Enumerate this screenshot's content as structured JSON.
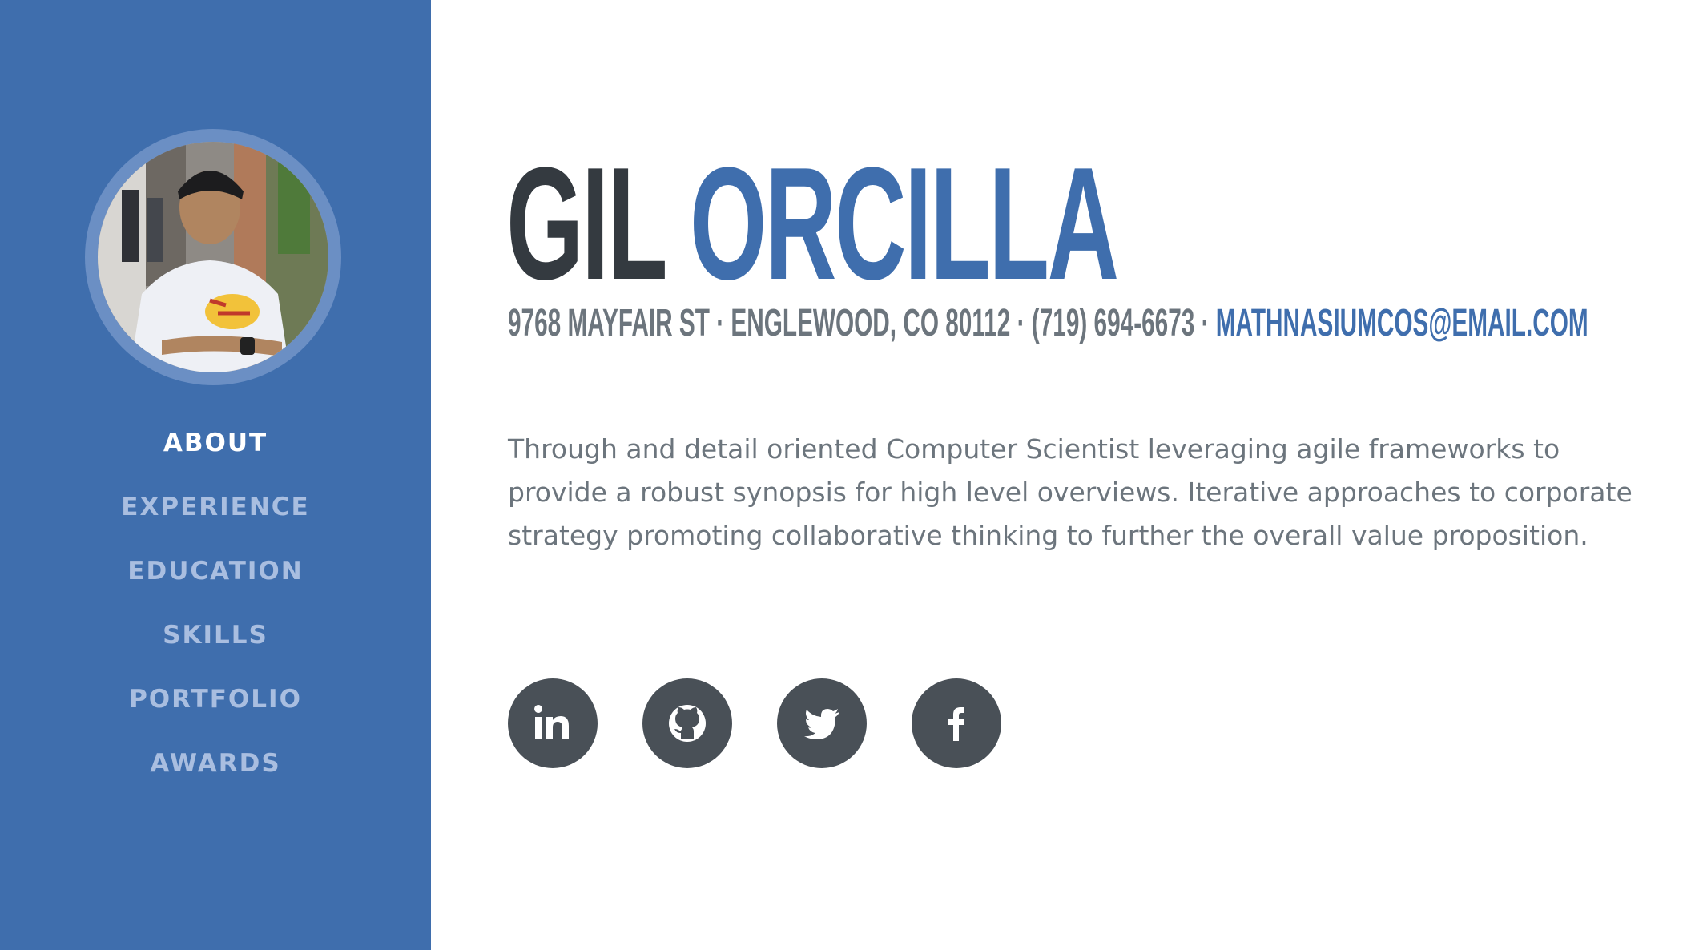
{
  "profile": {
    "first_name": "GIL",
    "last_name": "ORCILLA",
    "address": "9768 MAYFAIR ST · ENGLEWOOD, CO 80112 · (719) 694-6673 ·",
    "email": "MATHNASIUMCOS@EMAIL.COM",
    "summary": "Through and detail oriented Computer Scientist leveraging agile frameworks to provide a robust synopsis for high level overviews. Iterative approaches to corporate strategy promoting collaborative thinking to further the overall value proposition."
  },
  "nav": {
    "items": [
      {
        "label": "ABOUT",
        "active": true
      },
      {
        "label": "EXPERIENCE",
        "active": false
      },
      {
        "label": "EDUCATION",
        "active": false
      },
      {
        "label": "SKILLS",
        "active": false
      },
      {
        "label": "PORTFOLIO",
        "active": false
      },
      {
        "label": "AWARDS",
        "active": false
      }
    ]
  },
  "social": {
    "icons": [
      "linkedin-icon",
      "github-icon",
      "twitter-icon",
      "facebook-icon"
    ]
  },
  "colors": {
    "accent": "#3f6ead",
    "sidebar_bg": "#3f6ead",
    "nav_inactive": "#a9bee0",
    "name_dark": "#343a40",
    "text_gray": "#6c757d",
    "social_bg": "#495057"
  }
}
